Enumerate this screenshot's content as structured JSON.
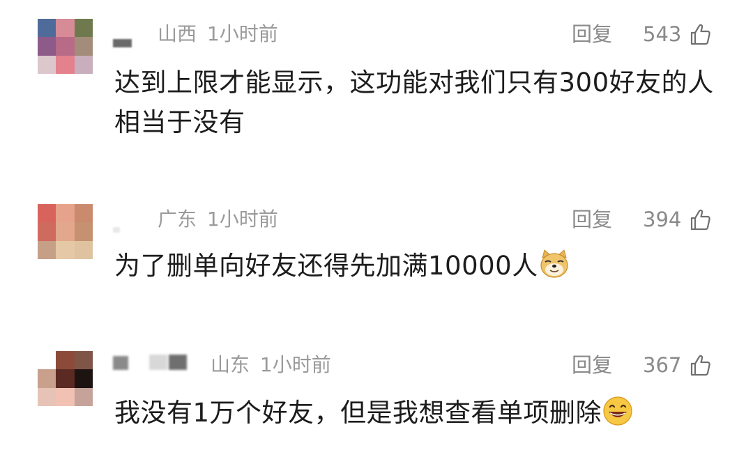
{
  "comments": [
    {
      "location": "山西",
      "time": "1小时前",
      "reply_label": "回复",
      "likes": "543",
      "text": "达到上限才能显示，这功能对我们只有300好友的人相当于没有",
      "avatar_colors": [
        "#4f6b9a",
        "#d78b97",
        "#6e7a4d",
        "#8d5a8a",
        "#b86a86",
        "#a48c7b",
        "#dcc7cd",
        "#e3818d",
        "#c9aebd"
      ]
    },
    {
      "location": "广东",
      "time": "1小时前",
      "reply_label": "回复",
      "likes": "394",
      "text": "为了删单向好友还得先加满10000人",
      "emoji": "doge-emoji",
      "avatar_colors": [
        "#d8635c",
        "#e7a28c",
        "#c98a6e",
        "#cf6a5e",
        "#e2a78c",
        "#c69170",
        "#c6a086",
        "#e5c8a6",
        "#dfc3a0"
      ]
    },
    {
      "location": "山东",
      "time": "1小时前",
      "reply_label": "回复",
      "likes": "367",
      "text": "我没有1万个好友，但是我想查看单项删除",
      "emoji": "grin-emoji",
      "avatar_colors": [
        "#ffffff",
        "#8b4a3a",
        "#7e5547",
        "#c9a08c",
        "#5a2a23",
        "#1d1412",
        "#e7c3b7",
        "#f1c1b3",
        "#c5a39a"
      ]
    }
  ]
}
